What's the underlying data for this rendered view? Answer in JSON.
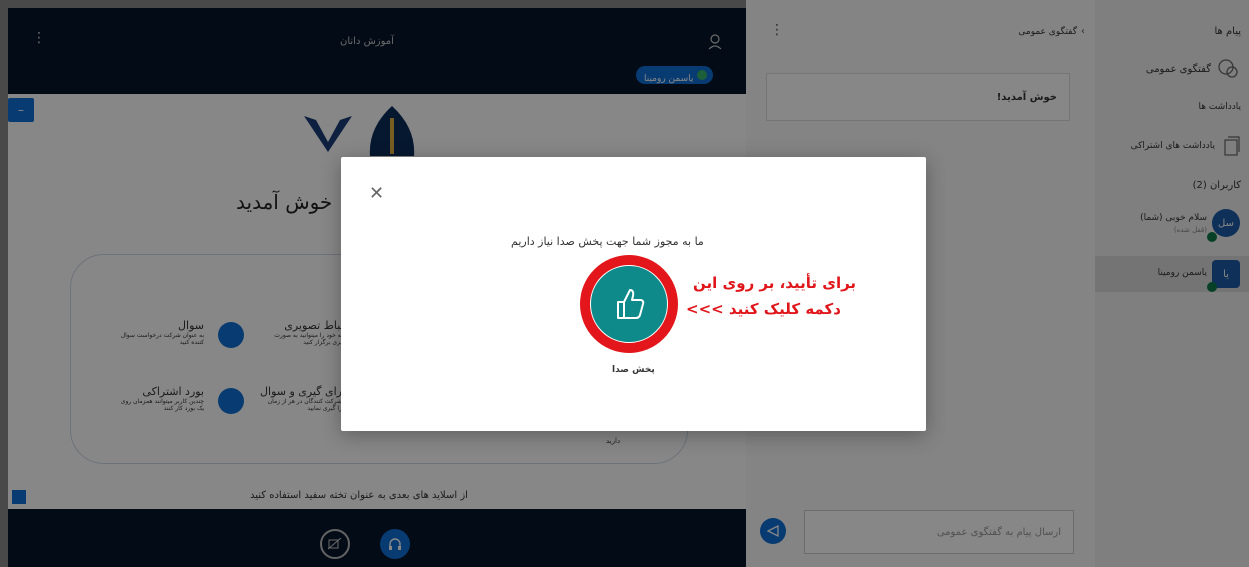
{
  "sidebar": {
    "messages_title": "پیام ها",
    "public_chat": "گفتگوی عمومی",
    "notes_title": "یادداشت ها",
    "shared_notes": "یادداشت های اشتراکی",
    "users_title": "کاربران (2)",
    "users": [
      {
        "initials": "سل",
        "name": "سلام خوبی (شما)",
        "status": "(قفل شده)"
      },
      {
        "initials": "یا",
        "name": "یاسمن رومینا"
      }
    ]
  },
  "chat": {
    "header": "گفتگوی عمومی",
    "welcome": "خوش آمدید!",
    "input_placeholder": "ارسال پیام به گفتگوی عمومی"
  },
  "presentation": {
    "title": "آموزش دانان",
    "presenter": "یاسمن رومینا",
    "slide_heading": "خوش آمدید",
    "features": [
      {
        "title": "ارتباط تصویری",
        "desc": "جلسه خود را میتوانید به صورت تصویری برگزار کنید"
      },
      {
        "title": "سوال",
        "desc": "به عنوان شرکت درخواست سوال کننده کنید"
      },
      {
        "title": "رای گیری و سوال",
        "desc": "شرکت کنندگان در هر از زمان را گیری نمایید"
      },
      {
        "title": "بورد اشتراکی",
        "desc": "چندین کاربر میتوانند همزمان روی یک بورد کار کنند"
      }
    ],
    "side_text": "دارید",
    "footer_note": "از اسلاید های بعدی به عنوان تخته سفید استفاده کنید"
  },
  "modal": {
    "message": "ما به مجوز شما جهت پخش صدا نیاز داریم",
    "play_label": "پخش صدا",
    "annotation_line1": "برای تأیید، بر روی این",
    "annotation_line2": "دکمه کلیک کنید >>>"
  },
  "colors": {
    "brand": "#0f70d7",
    "dark": "#06172a",
    "teal": "#0e8a8a",
    "annot": "#e0161b"
  }
}
